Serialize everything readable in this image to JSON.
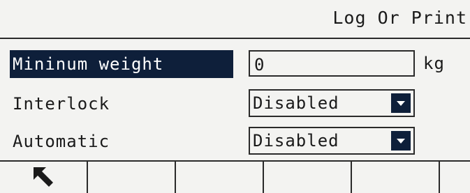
{
  "header": {
    "title": "Log Or Print"
  },
  "fields": {
    "minimum_weight": {
      "label": "Mininum weight",
      "value": "0",
      "unit": "kg"
    },
    "interlock": {
      "label": "Interlock",
      "value": "Disabled"
    },
    "automatic": {
      "label": "Automatic",
      "value": "Disabled"
    }
  },
  "softkeys": [
    {
      "icon": "back-arrow-icon"
    },
    {
      "icon": ""
    },
    {
      "icon": ""
    },
    {
      "icon": ""
    },
    {
      "icon": ""
    },
    {
      "icon": ""
    }
  ],
  "colors": {
    "background": "#f3f3f1",
    "highlight": "#0e1f3a",
    "border": "#2a2a2a"
  }
}
